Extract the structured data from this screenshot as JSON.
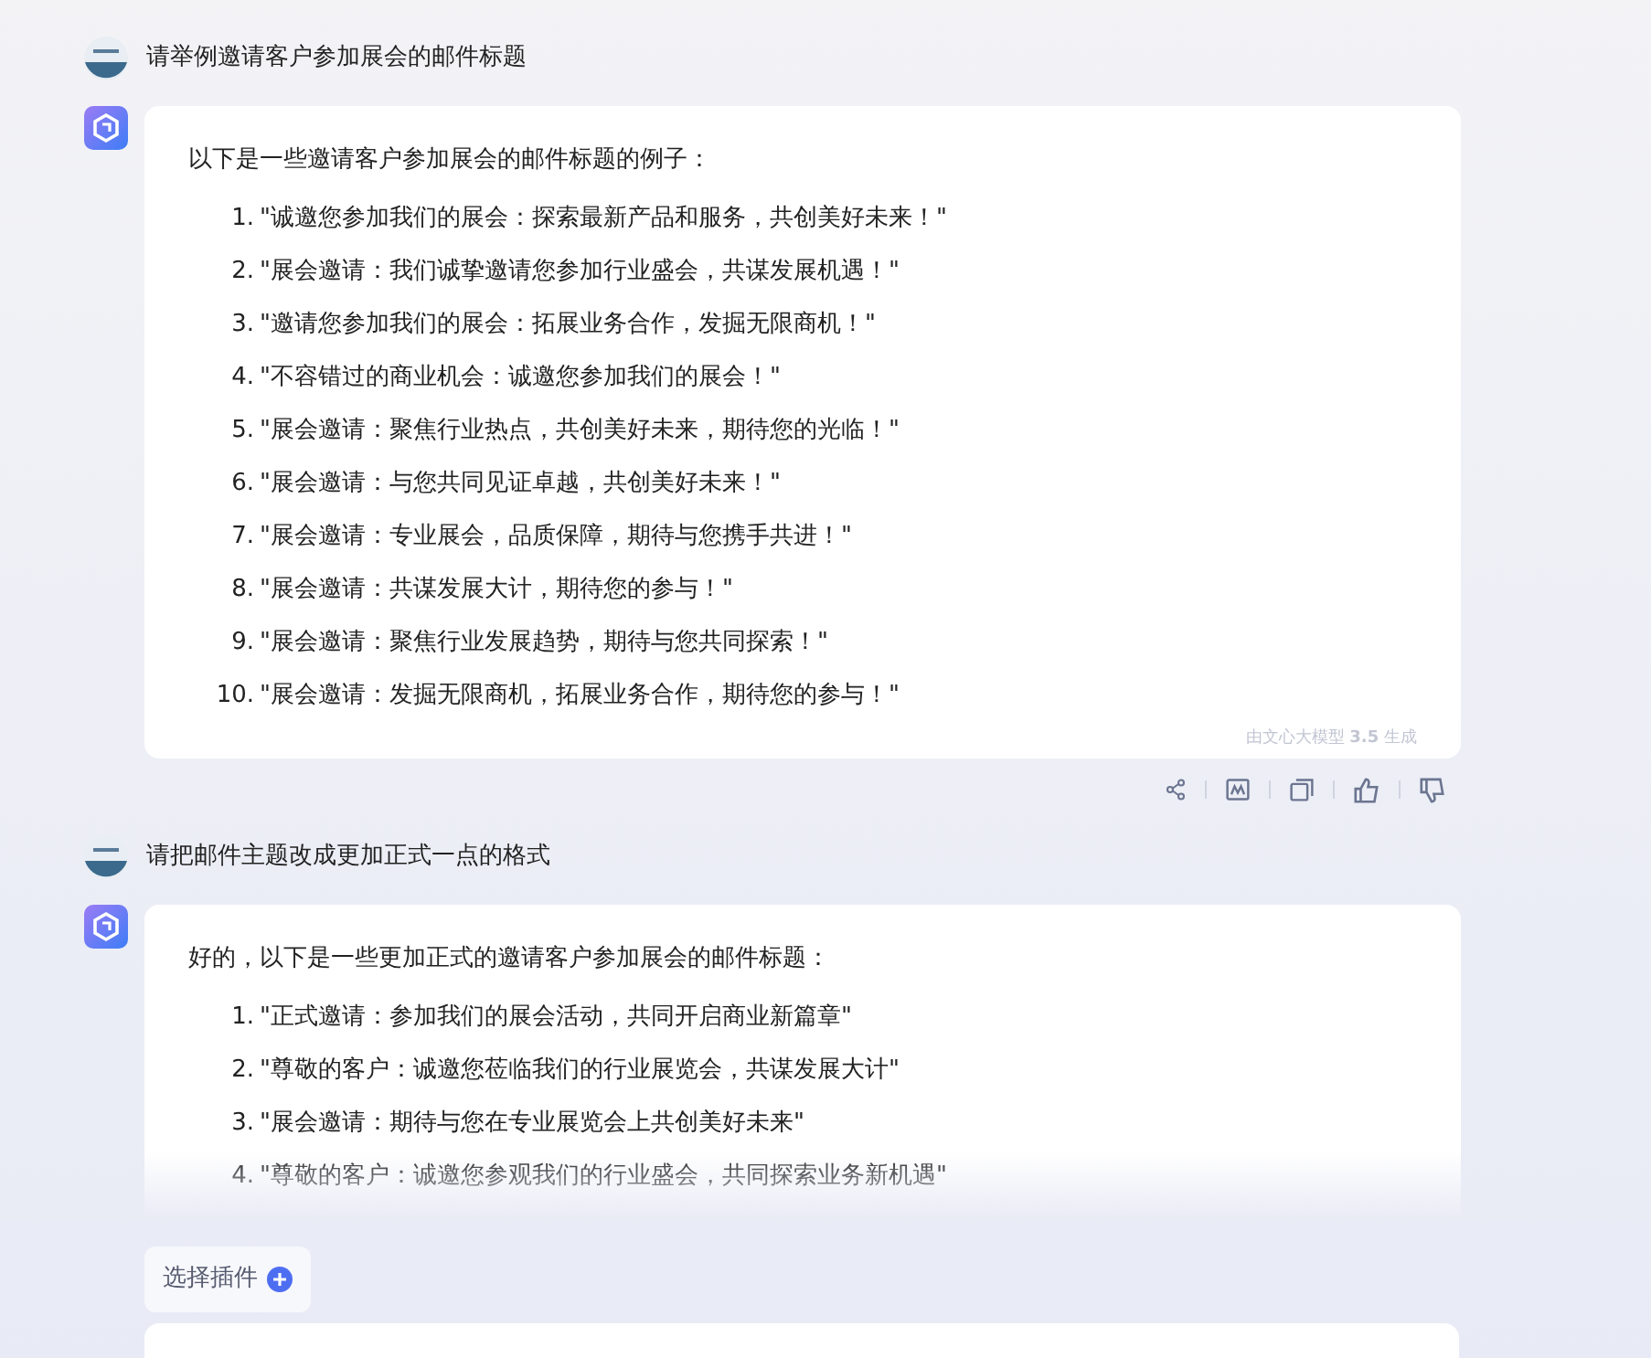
{
  "conversation": [
    {
      "kind": "user",
      "text": "请举例邀请客户参加展会的邮件标题"
    },
    {
      "kind": "bot",
      "intro": "以下是一些邀请客户参加展会的邮件标题的例子：",
      "items": [
        {
          "number": "1.",
          "text": "\"诚邀您参加我们的展会：探索最新产品和服务，共创美好未来！\""
        },
        {
          "number": "2.",
          "text": "\"展会邀请：我们诚挚邀请您参加行业盛会，共谋发展机遇！\""
        },
        {
          "number": "3.",
          "text": "\"邀请您参加我们的展会：拓展业务合作，发掘无限商机！\""
        },
        {
          "number": "4.",
          "text": "\"不容错过的商业机会：诚邀您参加我们的展会！\""
        },
        {
          "number": "5.",
          "text": "\"展会邀请：聚焦行业热点，共创美好未来，期待您的光临！\""
        },
        {
          "number": "6.",
          "text": "\"展会邀请：与您共同见证卓越，共创美好未来！\""
        },
        {
          "number": "7.",
          "text": "\"展会邀请：专业展会，品质保障，期待与您携手共进！\""
        },
        {
          "number": "8.",
          "text": "\"展会邀请：共谋发展大计，期待您的参与！\""
        },
        {
          "number": "9.",
          "text": "\"展会邀请：聚焦行业发展趋势，期待与您共同探索！\""
        },
        {
          "number": "10.",
          "text": "\"展会邀请：发掘无限商机，拓展业务合作，期待您的参与！\""
        }
      ],
      "footer": "由文心大模型 **3.5** 生成"
    },
    {
      "kind": "user",
      "text": "请把邮件主题改成更加正式一点的格式"
    },
    {
      "kind": "bot",
      "intro": "好的，以下是一些更加正式的邀请客户参加展会的邮件标题：",
      "items": [
        {
          "number": "1.",
          "text": "\"正式邀请：参加我们的展会活动，共同开启商业新篇章\""
        },
        {
          "number": "2.",
          "text": "\"尊敬的客户：诚邀您莅临我们的行业展览会，共谋发展大计\""
        },
        {
          "number": "3.",
          "text": "\"展会邀请：期待与您在专业展览会上共创美好未来\""
        },
        {
          "number": "4.",
          "text": "\"尊敬的客户：诚邀您参观我们的行业盛会，共同探索业务新机遇\""
        }
      ],
      "partial": true
    }
  ],
  "plugin_button": "选择插件"
}
